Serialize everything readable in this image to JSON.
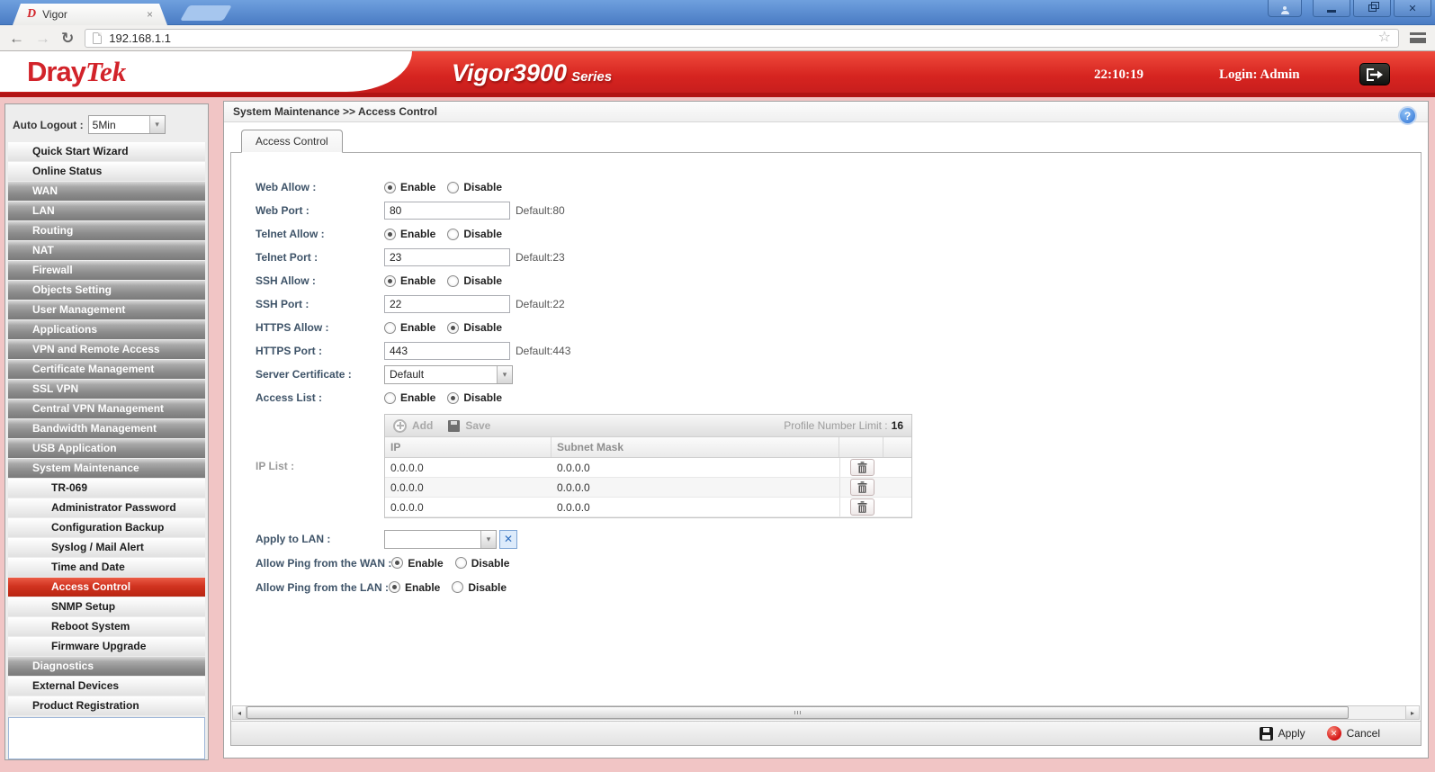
{
  "browser": {
    "tab_title": "Vigor",
    "favicon_letter": "D",
    "close_tab": "×",
    "url": "192.168.1.1"
  },
  "header": {
    "brand_dray": "Dray",
    "brand_tek": "Tek",
    "product": "Vigor3900",
    "series": "Series",
    "time": "22:10:19",
    "login": "Login: Admin"
  },
  "sidebar": {
    "auto_logout_label": "Auto Logout :",
    "auto_logout_value": "5Min",
    "items": [
      {
        "label": "Quick Start Wizard",
        "type": "light"
      },
      {
        "label": "Online Status",
        "type": "light"
      },
      {
        "label": "WAN",
        "type": "group"
      },
      {
        "label": "LAN",
        "type": "group"
      },
      {
        "label": "Routing",
        "type": "group"
      },
      {
        "label": "NAT",
        "type": "group"
      },
      {
        "label": "Firewall",
        "type": "group"
      },
      {
        "label": "Objects Setting",
        "type": "group"
      },
      {
        "label": "User Management",
        "type": "group"
      },
      {
        "label": "Applications",
        "type": "group"
      },
      {
        "label": "VPN and Remote Access",
        "type": "group"
      },
      {
        "label": "Certificate Management",
        "type": "group"
      },
      {
        "label": "SSL VPN",
        "type": "group"
      },
      {
        "label": "Central VPN Management",
        "type": "group"
      },
      {
        "label": "Bandwidth Management",
        "type": "group"
      },
      {
        "label": "USB Application",
        "type": "group"
      },
      {
        "label": "System Maintenance",
        "type": "group"
      },
      {
        "label": "TR-069",
        "type": "sub"
      },
      {
        "label": "Administrator Password",
        "type": "sub"
      },
      {
        "label": "Configuration Backup",
        "type": "sub"
      },
      {
        "label": "Syslog / Mail Alert",
        "type": "sub"
      },
      {
        "label": "Time and Date",
        "type": "sub"
      },
      {
        "label": "Access Control",
        "type": "sub-selected"
      },
      {
        "label": "SNMP Setup",
        "type": "sub"
      },
      {
        "label": "Reboot System",
        "type": "sub"
      },
      {
        "label": "Firmware Upgrade",
        "type": "sub"
      },
      {
        "label": "Diagnostics",
        "type": "group"
      },
      {
        "label": "External Devices",
        "type": "light"
      },
      {
        "label": "Product Registration",
        "type": "light"
      }
    ]
  },
  "main": {
    "breadcrumb": "System Maintenance >> Access Control",
    "tab_label": "Access Control",
    "help_glyph": "?"
  },
  "form": {
    "enable": "Enable",
    "disable": "Disable",
    "web_allow_label": "Web Allow :",
    "web_allow_value": "enable",
    "web_port_label": "Web Port :",
    "web_port_value": "80",
    "web_port_default": "Default:80",
    "telnet_allow_label": "Telnet Allow :",
    "telnet_allow_value": "enable",
    "telnet_port_label": "Telnet Port :",
    "telnet_port_value": "23",
    "telnet_port_default": "Default:23",
    "ssh_allow_label": "SSH Allow :",
    "ssh_allow_value": "enable",
    "ssh_port_label": "SSH Port :",
    "ssh_port_value": "22",
    "ssh_port_default": "Default:22",
    "https_allow_label": "HTTPS Allow :",
    "https_allow_value": "disable",
    "https_port_label": "HTTPS Port :",
    "https_port_value": "443",
    "https_port_default": "Default:443",
    "server_certificate_label": "Server Certificate :",
    "server_certificate_value": "Default",
    "access_list_label": "Access List :",
    "apply_to_lan_label": "Apply to LAN :",
    "apply_to_lan_value": "",
    "access_list_value": "disable",
    "ping_wan_label": "Allow Ping from the WAN :",
    "ping_wan_value": "enable",
    "ping_lan_label": "Allow Ping from the LAN :",
    "ping_lan_value": "enable"
  },
  "ip_list": {
    "label": "IP List :",
    "add_label": "Add",
    "save_label": "Save",
    "profile_limit_label": "Profile Number Limit :",
    "profile_limit_value": "16",
    "columns": [
      "IP",
      "Subnet Mask"
    ],
    "rows": [
      [
        "0.0.0.0",
        "0.0.0.0"
      ],
      [
        "0.0.0.0",
        "0.0.0.0"
      ],
      [
        "0.0.0.0",
        "0.0.0.0"
      ]
    ]
  },
  "footer": {
    "apply_label": "Apply",
    "cancel_label": "Cancel"
  }
}
